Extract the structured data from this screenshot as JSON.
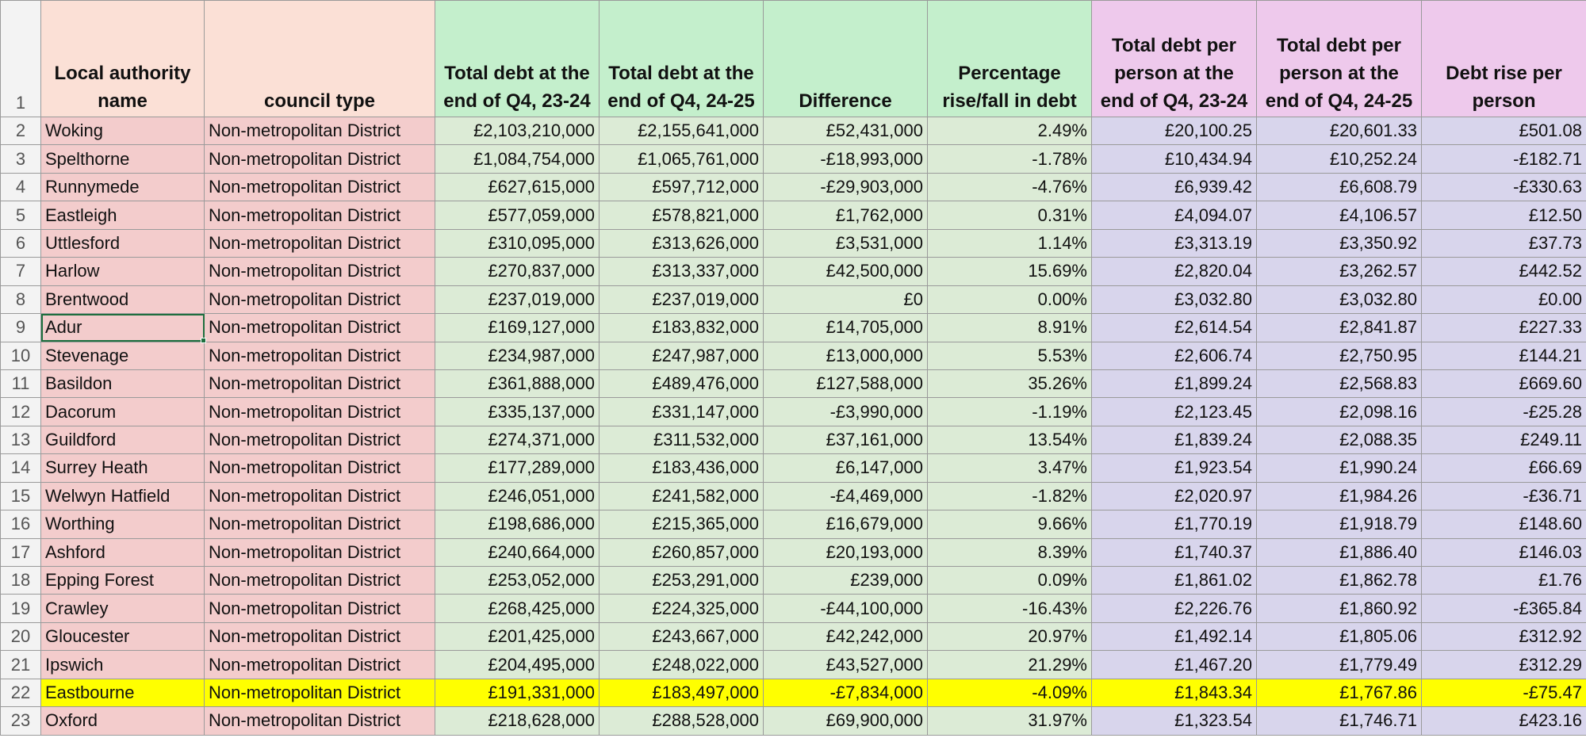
{
  "headers": {
    "row_number": "1",
    "name": "Local authority name",
    "type": "council type",
    "debt_2324": "Total debt at the end of Q4, 23-24",
    "debt_2425": "Total debt at the end of Q4, 24-25",
    "difference": "Difference",
    "pct_change": "Percentage rise/fall in debt",
    "per_person_2324": "Total debt per person at the end of Q4, 23-24",
    "per_person_2425": "Total debt per person at the end of Q4, 24-25",
    "rise_per_person": "Debt rise per person"
  },
  "colors": {
    "name_type_header": "#fbe0d6",
    "debt_header": "#c4efcc",
    "per_person_header": "#eec9ec",
    "highlight_row": "#ffff00",
    "selection": "#1e6f3e"
  },
  "selected_cell": "A9",
  "rows": [
    {
      "n": "2",
      "name": "Woking",
      "type": "Non-metropolitan District",
      "d1": "£2,103,210,000",
      "d2": "£2,155,641,000",
      "diff": "£52,431,000",
      "pct": "2.49%",
      "pp1": "£20,100.25",
      "pp2": "£20,601.33",
      "rise": "£501.08"
    },
    {
      "n": "3",
      "name": "Spelthorne",
      "type": "Non-metropolitan District",
      "d1": "£1,084,754,000",
      "d2": "£1,065,761,000",
      "diff": "-£18,993,000",
      "pct": "-1.78%",
      "pp1": "£10,434.94",
      "pp2": "£10,252.24",
      "rise": "-£182.71"
    },
    {
      "n": "4",
      "name": "Runnymede",
      "type": "Non-metropolitan District",
      "d1": "£627,615,000",
      "d2": "£597,712,000",
      "diff": "-£29,903,000",
      "pct": "-4.76%",
      "pp1": "£6,939.42",
      "pp2": "£6,608.79",
      "rise": "-£330.63"
    },
    {
      "n": "5",
      "name": "Eastleigh",
      "type": "Non-metropolitan District",
      "d1": "£577,059,000",
      "d2": "£578,821,000",
      "diff": "£1,762,000",
      "pct": "0.31%",
      "pp1": "£4,094.07",
      "pp2": "£4,106.57",
      "rise": "£12.50"
    },
    {
      "n": "6",
      "name": "Uttlesford",
      "type": "Non-metropolitan District",
      "d1": "£310,095,000",
      "d2": "£313,626,000",
      "diff": "£3,531,000",
      "pct": "1.14%",
      "pp1": "£3,313.19",
      "pp2": "£3,350.92",
      "rise": "£37.73"
    },
    {
      "n": "7",
      "name": "Harlow",
      "type": "Non-metropolitan District",
      "d1": "£270,837,000",
      "d2": "£313,337,000",
      "diff": "£42,500,000",
      "pct": "15.69%",
      "pp1": "£2,820.04",
      "pp2": "£3,262.57",
      "rise": "£442.52"
    },
    {
      "n": "8",
      "name": "Brentwood",
      "type": "Non-metropolitan District",
      "d1": "£237,019,000",
      "d2": "£237,019,000",
      "diff": "£0",
      "pct": "0.00%",
      "pp1": "£3,032.80",
      "pp2": "£3,032.80",
      "rise": "£0.00"
    },
    {
      "n": "9",
      "name": "Adur",
      "type": "Non-metropolitan District",
      "d1": "£169,127,000",
      "d2": "£183,832,000",
      "diff": "£14,705,000",
      "pct": "8.91%",
      "pp1": "£2,614.54",
      "pp2": "£2,841.87",
      "rise": "£227.33"
    },
    {
      "n": "10",
      "name": "Stevenage",
      "type": "Non-metropolitan District",
      "d1": "£234,987,000",
      "d2": "£247,987,000",
      "diff": "£13,000,000",
      "pct": "5.53%",
      "pp1": "£2,606.74",
      "pp2": "£2,750.95",
      "rise": "£144.21"
    },
    {
      "n": "11",
      "name": "Basildon",
      "type": "Non-metropolitan District",
      "d1": "£361,888,000",
      "d2": "£489,476,000",
      "diff": "£127,588,000",
      "pct": "35.26%",
      "pp1": "£1,899.24",
      "pp2": "£2,568.83",
      "rise": "£669.60"
    },
    {
      "n": "12",
      "name": "Dacorum",
      "type": "Non-metropolitan District",
      "d1": "£335,137,000",
      "d2": "£331,147,000",
      "diff": "-£3,990,000",
      "pct": "-1.19%",
      "pp1": "£2,123.45",
      "pp2": "£2,098.16",
      "rise": "-£25.28"
    },
    {
      "n": "13",
      "name": "Guildford",
      "type": "Non-metropolitan District",
      "d1": "£274,371,000",
      "d2": "£311,532,000",
      "diff": "£37,161,000",
      "pct": "13.54%",
      "pp1": "£1,839.24",
      "pp2": "£2,088.35",
      "rise": "£249.11"
    },
    {
      "n": "14",
      "name": "Surrey Heath",
      "type": "Non-metropolitan District",
      "d1": "£177,289,000",
      "d2": "£183,436,000",
      "diff": "£6,147,000",
      "pct": "3.47%",
      "pp1": "£1,923.54",
      "pp2": "£1,990.24",
      "rise": "£66.69"
    },
    {
      "n": "15",
      "name": "Welwyn Hatfield",
      "type": "Non-metropolitan District",
      "d1": "£246,051,000",
      "d2": "£241,582,000",
      "diff": "-£4,469,000",
      "pct": "-1.82%",
      "pp1": "£2,020.97",
      "pp2": "£1,984.26",
      "rise": "-£36.71"
    },
    {
      "n": "16",
      "name": "Worthing",
      "type": "Non-metropolitan District",
      "d1": "£198,686,000",
      "d2": "£215,365,000",
      "diff": "£16,679,000",
      "pct": "9.66%",
      "pp1": "£1,770.19",
      "pp2": "£1,918.79",
      "rise": "£148.60"
    },
    {
      "n": "17",
      "name": "Ashford",
      "type": "Non-metropolitan District",
      "d1": "£240,664,000",
      "d2": "£260,857,000",
      "diff": "£20,193,000",
      "pct": "8.39%",
      "pp1": "£1,740.37",
      "pp2": "£1,886.40",
      "rise": "£146.03"
    },
    {
      "n": "18",
      "name": "Epping Forest",
      "type": "Non-metropolitan District",
      "d1": "£253,052,000",
      "d2": "£253,291,000",
      "diff": "£239,000",
      "pct": "0.09%",
      "pp1": "£1,861.02",
      "pp2": "£1,862.78",
      "rise": "£1.76"
    },
    {
      "n": "19",
      "name": "Crawley",
      "type": "Non-metropolitan District",
      "d1": "£268,425,000",
      "d2": "£224,325,000",
      "diff": "-£44,100,000",
      "pct": "-16.43%",
      "pp1": "£2,226.76",
      "pp2": "£1,860.92",
      "rise": "-£365.84"
    },
    {
      "n": "20",
      "name": "Gloucester",
      "type": "Non-metropolitan District",
      "d1": "£201,425,000",
      "d2": "£243,667,000",
      "diff": "£42,242,000",
      "pct": "20.97%",
      "pp1": "£1,492.14",
      "pp2": "£1,805.06",
      "rise": "£312.92"
    },
    {
      "n": "21",
      "name": "Ipswich",
      "type": "Non-metropolitan District",
      "d1": "£204,495,000",
      "d2": "£248,022,000",
      "diff": "£43,527,000",
      "pct": "21.29%",
      "pp1": "£1,467.20",
      "pp2": "£1,779.49",
      "rise": "£312.29"
    },
    {
      "n": "22",
      "name": "Eastbourne",
      "type": "Non-metropolitan District",
      "d1": "£191,331,000",
      "d2": "£183,497,000",
      "diff": "-£7,834,000",
      "pct": "-4.09%",
      "pp1": "£1,843.34",
      "pp2": "£1,767.86",
      "rise": "-£75.47",
      "highlight": true
    },
    {
      "n": "23",
      "name": "Oxford",
      "type": "Non-metropolitan District",
      "d1": "£218,628,000",
      "d2": "£288,528,000",
      "diff": "£69,900,000",
      "pct": "31.97%",
      "pp1": "£1,323.54",
      "pp2": "£1,746.71",
      "rise": "£423.16"
    }
  ]
}
